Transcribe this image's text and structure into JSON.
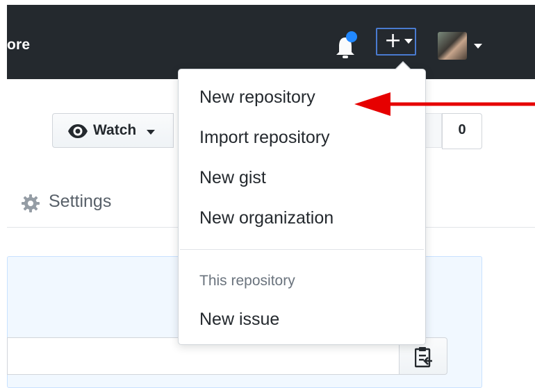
{
  "header": {
    "partial_text": "ore"
  },
  "repo_actions": {
    "watch_label": "Watch",
    "fork_count": "0"
  },
  "tabs": {
    "settings_label": "Settings"
  },
  "create_menu": {
    "items": [
      "New repository",
      "Import repository",
      "New gist",
      "New organization"
    ],
    "section_header": "This repository",
    "section_items": [
      "New issue"
    ]
  },
  "colors": {
    "header_bg": "#24292e",
    "notification_dot": "#2188ff",
    "annotation_arrow": "#e60000",
    "highlight_border": "#4a7bd0"
  },
  "icons": [
    "bell-icon",
    "plus-icon",
    "eye-icon",
    "gear-icon",
    "clipboard-icon"
  ]
}
